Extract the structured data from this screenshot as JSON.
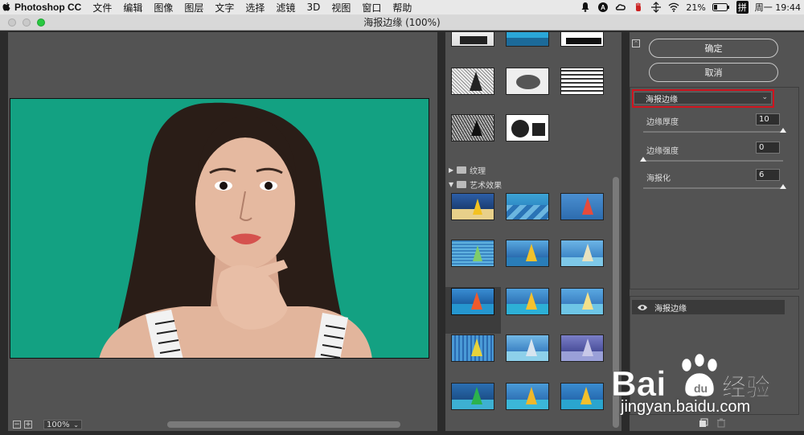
{
  "menubar": {
    "app_name": "Photoshop CC",
    "items": [
      "文件",
      "编辑",
      "图像",
      "图层",
      "文字",
      "选择",
      "滤镜",
      "3D",
      "视图",
      "窗口",
      "帮助"
    ],
    "status": {
      "battery": "21%",
      "input_method": "拼",
      "clock": "周一 19:44"
    }
  },
  "window": {
    "title": "海报边缘 (100%)"
  },
  "preview": {
    "zoom": "100%"
  },
  "gallery": {
    "categories": [
      {
        "label": "纹理",
        "expanded": false
      },
      {
        "label": "艺术效果",
        "expanded": true
      }
    ]
  },
  "panel": {
    "ok_label": "确定",
    "cancel_label": "取消",
    "filter_select": "海报边缘",
    "params": [
      {
        "label": "边缘厚度",
        "value": "10",
        "fraction": 1.0
      },
      {
        "label": "边缘强度",
        "value": "0",
        "fraction": 0.0
      },
      {
        "label": "海报化",
        "value": "6",
        "fraction": 1.0
      }
    ],
    "layer_name": "海报边缘"
  },
  "watermark": {
    "url": "jingyan.baidu.com"
  },
  "colors": {
    "photo_bg": "#16a889",
    "highlight": "#d0141e",
    "panel_bg": "#535353"
  }
}
